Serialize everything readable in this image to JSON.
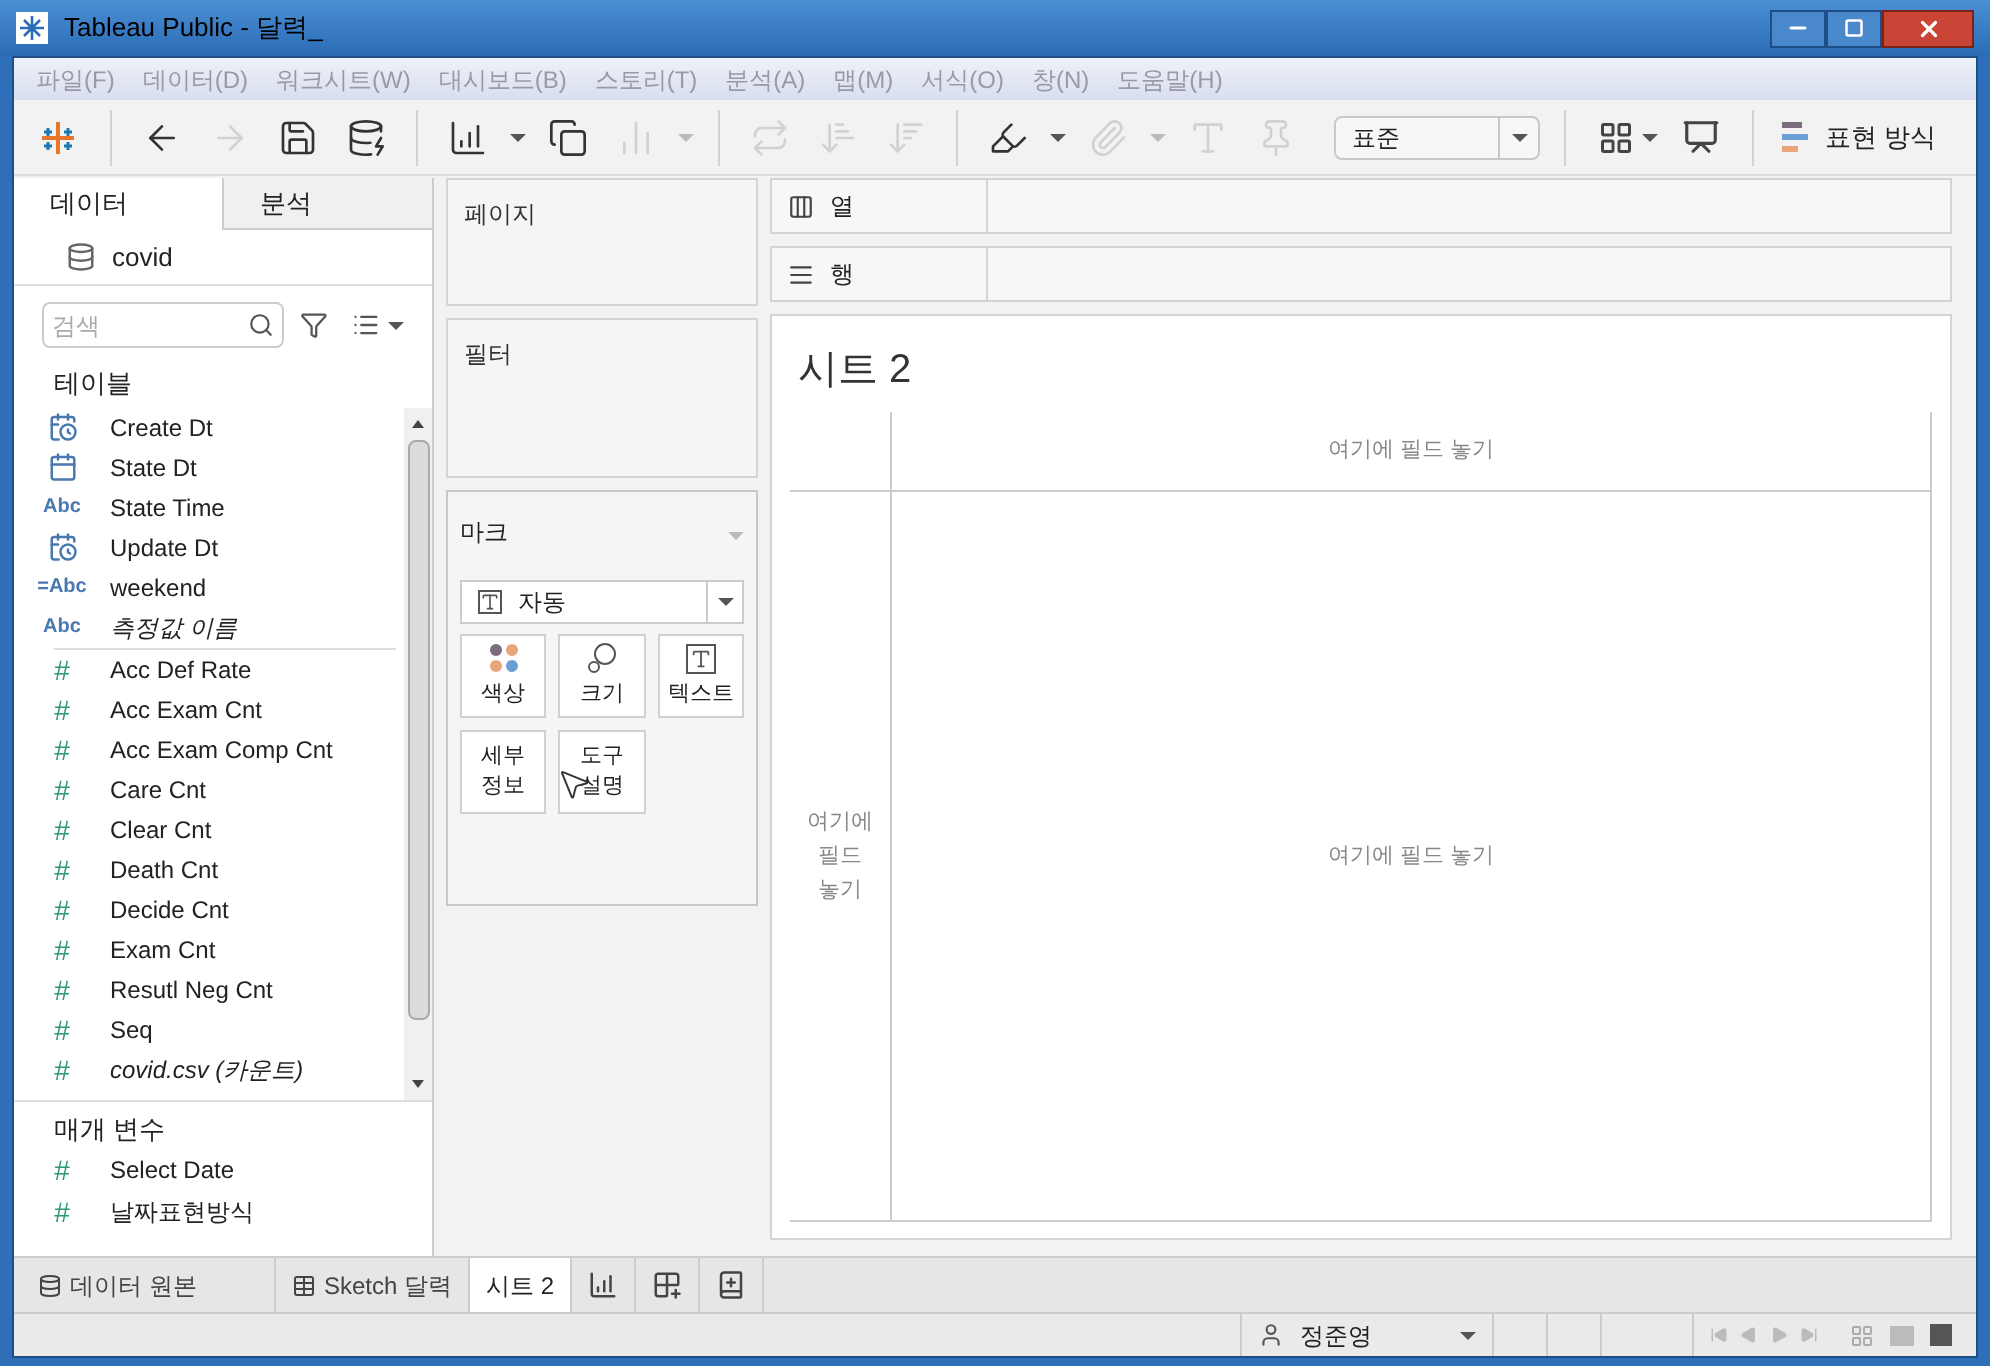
{
  "window": {
    "title": "Tableau Public - 달력_"
  },
  "menu": [
    "파일(F)",
    "데이터(D)",
    "워크시트(W)",
    "대시보드(B)",
    "스토리(T)",
    "분석(A)",
    "맵(M)",
    "서식(O)",
    "창(N)",
    "도움말(H)"
  ],
  "toolbar": [
    {
      "kind": "logo"
    },
    {
      "kind": "sep"
    },
    {
      "kind": "back",
      "disabled": false
    },
    {
      "kind": "forward",
      "disabled": true
    },
    {
      "kind": "save",
      "disabled": false
    },
    {
      "kind": "datasource",
      "disabled": false
    },
    {
      "kind": "sep"
    },
    {
      "kind": "newsheet",
      "disabled": false
    },
    {
      "kind": "caret",
      "disabled": false
    },
    {
      "kind": "duplicate",
      "disabled": false
    },
    {
      "kind": "clear",
      "disabled": true
    },
    {
      "kind": "caret",
      "disabled": true
    },
    {
      "kind": "sep"
    },
    {
      "kind": "swap",
      "disabled": true
    },
    {
      "kind": "sortasc",
      "disabled": true
    },
    {
      "kind": "sortdesc",
      "disabled": true
    },
    {
      "kind": "sep"
    },
    {
      "kind": "highlight",
      "disabled": false
    },
    {
      "kind": "caret",
      "disabled": false
    },
    {
      "kind": "attach",
      "disabled": true
    },
    {
      "kind": "caret",
      "disabled": true
    },
    {
      "kind": "label",
      "disabled": true
    },
    {
      "kind": "pin",
      "disabled": true
    }
  ],
  "fit_select": {
    "value": "표준"
  },
  "toolbar_right": [
    {
      "kind": "cards"
    },
    {
      "kind": "caret"
    },
    {
      "kind": "presentation"
    }
  ],
  "show_me": {
    "label": "표현 방식"
  },
  "side_tabs": [
    {
      "label": "데이터",
      "selected": true
    },
    {
      "label": "분석",
      "selected": false
    }
  ],
  "datasource": {
    "name": "covid"
  },
  "search": {
    "placeholder": "검색"
  },
  "tables_heading": "테이블",
  "fields": [
    {
      "kind": "datetime",
      "name": "Create Dt",
      "italic": false
    },
    {
      "kind": "date",
      "name": "State Dt",
      "italic": false
    },
    {
      "kind": "string",
      "icon": "Abc",
      "name": "State Time",
      "italic": false
    },
    {
      "kind": "datetime",
      "name": "Update Dt",
      "italic": false
    },
    {
      "kind": "calc-string",
      "icon": "=Abc",
      "name": "weekend",
      "italic": false
    },
    {
      "kind": "string",
      "icon": "Abc",
      "name": "측정값 이름",
      "italic": true
    },
    {
      "kind": "divider"
    },
    {
      "kind": "measure",
      "icon": "#",
      "name": "Acc Def Rate",
      "italic": false
    },
    {
      "kind": "measure",
      "icon": "#",
      "name": "Acc Exam Cnt",
      "italic": false
    },
    {
      "kind": "measure",
      "icon": "#",
      "name": "Acc Exam Comp Cnt",
      "italic": false
    },
    {
      "kind": "measure",
      "icon": "#",
      "name": "Care Cnt",
      "italic": false
    },
    {
      "kind": "measure",
      "icon": "#",
      "name": "Clear Cnt",
      "italic": false
    },
    {
      "kind": "measure",
      "icon": "#",
      "name": "Death Cnt",
      "italic": false
    },
    {
      "kind": "measure",
      "icon": "#",
      "name": "Decide Cnt",
      "italic": false
    },
    {
      "kind": "measure",
      "icon": "#",
      "name": "Exam Cnt",
      "italic": false
    },
    {
      "kind": "measure",
      "icon": "#",
      "name": "Resutl Neg Cnt",
      "italic": false
    },
    {
      "kind": "measure",
      "icon": "#",
      "name": "Seq",
      "italic": false
    },
    {
      "kind": "measure",
      "icon": "#",
      "name": "covid.csv (카운트)",
      "italic": true
    }
  ],
  "parameters_heading": "매개 변수",
  "parameters": [
    {
      "kind": "measure",
      "icon": "#",
      "name": "Select Date"
    },
    {
      "kind": "measure",
      "icon": "#",
      "name": "날짜표현방식"
    }
  ],
  "pages_card": {
    "title": "페이지"
  },
  "filters_card": {
    "title": "필터"
  },
  "marks_card": {
    "title": "마크",
    "mark_type": "자동",
    "buttons": [
      {
        "kind": "color",
        "label": "색상"
      },
      {
        "kind": "size",
        "label": "크기"
      },
      {
        "kind": "text",
        "label": "텍스트"
      },
      {
        "kind": "detail",
        "label": "세부 정보"
      },
      {
        "kind": "tooltip",
        "label": "도구 설명"
      }
    ]
  },
  "shelves": [
    {
      "kind": "columns",
      "label": "열"
    },
    {
      "kind": "rows",
      "label": "행"
    }
  ],
  "view": {
    "title": "시트 2",
    "top_drop": "여기에 필드 놓기",
    "left_drop": "여기에 필드 놓기",
    "center_drop": "여기에 필드 놓기"
  },
  "sheet_tabs": [
    {
      "kind": "datasource",
      "label": "데이터 원본",
      "selected": false
    },
    {
      "kind": "dashboard",
      "label": "Sketch 달력",
      "selected": false
    },
    {
      "kind": "sheet",
      "label": "시트 2",
      "selected": true
    }
  ],
  "new_tabs": [
    {
      "kind": "worksheet"
    },
    {
      "kind": "dashboard"
    },
    {
      "kind": "story"
    }
  ],
  "status_bar": {
    "user": "정준영"
  }
}
